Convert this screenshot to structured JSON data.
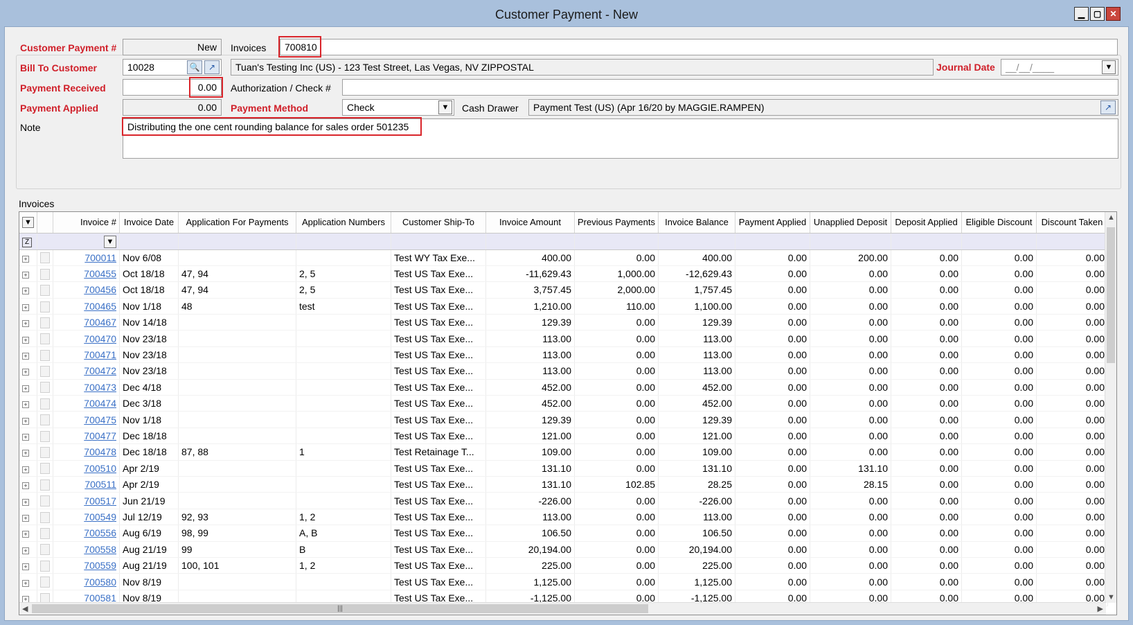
{
  "window": {
    "title": "Customer Payment - New",
    "min": "▁",
    "max": "▢",
    "close": "✕"
  },
  "form": {
    "payment_no_label": "Customer Payment #",
    "payment_no_value": "New",
    "invoices_label": "Invoices",
    "invoices_value": "700810",
    "bill_to_label": "Bill To Customer",
    "bill_to_value": "10028",
    "bill_to_desc": "Tuan's Testing Inc (US) - 123 Test Street, Las Vegas, NV  ZIPPOSTAL",
    "journal_date_label": "Journal Date",
    "journal_date_value": "__/__/____",
    "payment_received_label": "Payment Received",
    "payment_received_value": "0.00",
    "auth_label": "Authorization / Check #",
    "auth_value": "",
    "payment_applied_label": "Payment Applied",
    "payment_applied_value": "0.00",
    "payment_method_label": "Payment Method",
    "payment_method_value": "Check",
    "cash_drawer_label": "Cash Drawer",
    "cash_drawer_value": "Payment Test (US) (Apr 16/20 by MAGGIE.RAMPEN)",
    "note_label": "Note",
    "note_value": "Distributing the one cent rounding balance for sales order 501235"
  },
  "grid": {
    "caption": "Invoices",
    "columns": [
      "Invoice #",
      "Invoice Date",
      "Application For Payments",
      "Application Numbers",
      "Customer Ship-To",
      "Invoice Amount",
      "Previous Payments",
      "Invoice Balance",
      "Payment Applied",
      "Unapplied Deposit",
      "Deposit Applied",
      "Eligible Discount",
      "Discount Taken"
    ],
    "rows": [
      [
        "700011",
        "Nov 6/08",
        "",
        "",
        "Test WY Tax Exe...",
        "400.00",
        "0.00",
        "400.00",
        "0.00",
        "200.00",
        "0.00",
        "0.00",
        "0.00"
      ],
      [
        "700455",
        "Oct 18/18",
        "47, 94",
        "2, 5",
        "Test US Tax Exe...",
        "-11,629.43",
        "1,000.00",
        "-12,629.43",
        "0.00",
        "0.00",
        "0.00",
        "0.00",
        "0.00"
      ],
      [
        "700456",
        "Oct 18/18",
        "47, 94",
        "2, 5",
        "Test US Tax Exe...",
        "3,757.45",
        "2,000.00",
        "1,757.45",
        "0.00",
        "0.00",
        "0.00",
        "0.00",
        "0.00"
      ],
      [
        "700465",
        "Nov 1/18",
        "48",
        "test",
        "Test US Tax Exe...",
        "1,210.00",
        "110.00",
        "1,100.00",
        "0.00",
        "0.00",
        "0.00",
        "0.00",
        "0.00"
      ],
      [
        "700467",
        "Nov 14/18",
        "",
        "",
        "Test US Tax Exe...",
        "129.39",
        "0.00",
        "129.39",
        "0.00",
        "0.00",
        "0.00",
        "0.00",
        "0.00"
      ],
      [
        "700470",
        "Nov 23/18",
        "",
        "",
        "Test US Tax Exe...",
        "113.00",
        "0.00",
        "113.00",
        "0.00",
        "0.00",
        "0.00",
        "0.00",
        "0.00"
      ],
      [
        "700471",
        "Nov 23/18",
        "",
        "",
        "Test US Tax Exe...",
        "113.00",
        "0.00",
        "113.00",
        "0.00",
        "0.00",
        "0.00",
        "0.00",
        "0.00"
      ],
      [
        "700472",
        "Nov 23/18",
        "",
        "",
        "Test US Tax Exe...",
        "113.00",
        "0.00",
        "113.00",
        "0.00",
        "0.00",
        "0.00",
        "0.00",
        "0.00"
      ],
      [
        "700473",
        "Dec 4/18",
        "",
        "",
        "Test US Tax Exe...",
        "452.00",
        "0.00",
        "452.00",
        "0.00",
        "0.00",
        "0.00",
        "0.00",
        "0.00"
      ],
      [
        "700474",
        "Dec 3/18",
        "",
        "",
        "Test US Tax Exe...",
        "452.00",
        "0.00",
        "452.00",
        "0.00",
        "0.00",
        "0.00",
        "0.00",
        "0.00"
      ],
      [
        "700475",
        "Nov 1/18",
        "",
        "",
        "Test US Tax Exe...",
        "129.39",
        "0.00",
        "129.39",
        "0.00",
        "0.00",
        "0.00",
        "0.00",
        "0.00"
      ],
      [
        "700477",
        "Dec 18/18",
        "",
        "",
        "Test US Tax Exe...",
        "121.00",
        "0.00",
        "121.00",
        "0.00",
        "0.00",
        "0.00",
        "0.00",
        "0.00"
      ],
      [
        "700478",
        "Dec 18/18",
        "87, 88",
        "1",
        "Test Retainage T...",
        "109.00",
        "0.00",
        "109.00",
        "0.00",
        "0.00",
        "0.00",
        "0.00",
        "0.00"
      ],
      [
        "700510",
        "Apr 2/19",
        "",
        "",
        "Test US Tax Exe...",
        "131.10",
        "0.00",
        "131.10",
        "0.00",
        "131.10",
        "0.00",
        "0.00",
        "0.00"
      ],
      [
        "700511",
        "Apr 2/19",
        "",
        "",
        "Test US Tax Exe...",
        "131.10",
        "102.85",
        "28.25",
        "0.00",
        "28.15",
        "0.00",
        "0.00",
        "0.00"
      ],
      [
        "700517",
        "Jun 21/19",
        "",
        "",
        "Test US Tax Exe...",
        "-226.00",
        "0.00",
        "-226.00",
        "0.00",
        "0.00",
        "0.00",
        "0.00",
        "0.00"
      ],
      [
        "700549",
        "Jul 12/19",
        "92, 93",
        "1, 2",
        "Test US Tax Exe...",
        "113.00",
        "0.00",
        "113.00",
        "0.00",
        "0.00",
        "0.00",
        "0.00",
        "0.00"
      ],
      [
        "700556",
        "Aug 6/19",
        "98, 99",
        "A, B",
        "Test US Tax Exe...",
        "106.50",
        "0.00",
        "106.50",
        "0.00",
        "0.00",
        "0.00",
        "0.00",
        "0.00"
      ],
      [
        "700558",
        "Aug 21/19",
        "99",
        "B",
        "Test US Tax Exe...",
        "20,194.00",
        "0.00",
        "20,194.00",
        "0.00",
        "0.00",
        "0.00",
        "0.00",
        "0.00"
      ],
      [
        "700559",
        "Aug 21/19",
        "100, 101",
        "1, 2",
        "Test US Tax Exe...",
        "225.00",
        "0.00",
        "225.00",
        "0.00",
        "0.00",
        "0.00",
        "0.00",
        "0.00"
      ],
      [
        "700580",
        "Nov 8/19",
        "",
        "",
        "Test US Tax Exe...",
        "1,125.00",
        "0.00",
        "1,125.00",
        "0.00",
        "0.00",
        "0.00",
        "0.00",
        "0.00"
      ],
      [
        "700581",
        "Nov 8/19",
        "",
        "",
        "Test US Tax Exe...",
        "-1,125.00",
        "0.00",
        "-1,125.00",
        "0.00",
        "0.00",
        "0.00",
        "0.00",
        "0.00"
      ]
    ]
  },
  "icons": {
    "lookup": "magnifier-icon",
    "open": "open-link-icon",
    "dropdown": "chevron-down-icon",
    "filter": "filter-icon",
    "expand": "expand-plus-icon"
  },
  "colors": {
    "required_label": "#d0202a",
    "highlight": "#d9252b",
    "link": "#3a70c6"
  }
}
